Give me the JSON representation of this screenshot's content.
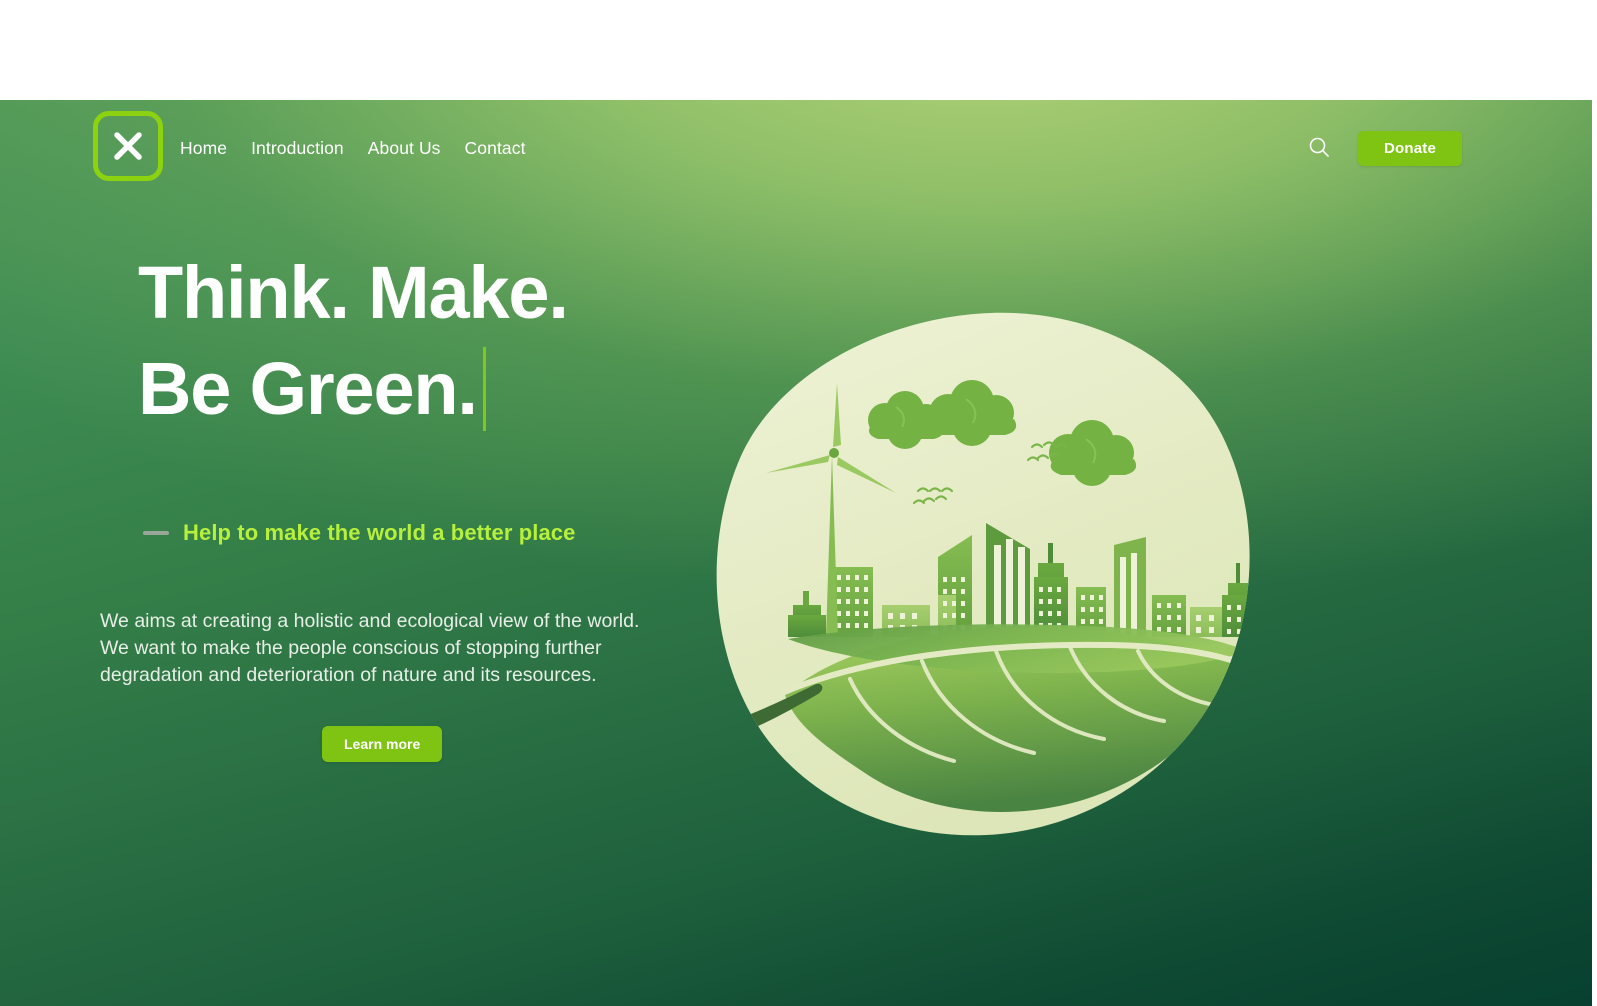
{
  "brand": {
    "logo_icon": "x-mark-logo-icon",
    "logo_border_color": "#8cd211"
  },
  "nav": {
    "items": [
      {
        "label": "Home"
      },
      {
        "label": "Introduction"
      },
      {
        "label": "About Us"
      },
      {
        "label": "Contact"
      }
    ]
  },
  "header_actions": {
    "search_icon": "search-icon",
    "donate_label": "Donate",
    "donate_color": "#7fc413"
  },
  "hero": {
    "headline_line1": "Think. Make.",
    "headline_line2": "Be Green.",
    "cursor_color": "#7ec81f",
    "tagline": "Help to make the world a better place",
    "tagline_color": "#b6f03c",
    "paragraph": "We aims at creating a holistic and ecological view of the world. We want to make the people conscious of stopping further degradation and deterioration of nature and its resources.",
    "cta_label": "Learn more",
    "cta_color": "#7fc413"
  },
  "illustration": {
    "name": "eco-city-leaf-illustration",
    "blob_color": "#e4ebc4",
    "leaf_gradient_from": "#9ccb56",
    "leaf_gradient_to": "#4f8b44",
    "stem_color": "#3e6b34",
    "elements": [
      "wind-turbine",
      "city-skyline",
      "tree-cloud",
      "bird-flock",
      "leaf"
    ]
  },
  "theme": {
    "gradient_light": "#a8d06f",
    "gradient_mid": "#358049",
    "gradient_dark": "#07402f",
    "text_white": "#ffffff",
    "body_text": "#e6eee6"
  }
}
